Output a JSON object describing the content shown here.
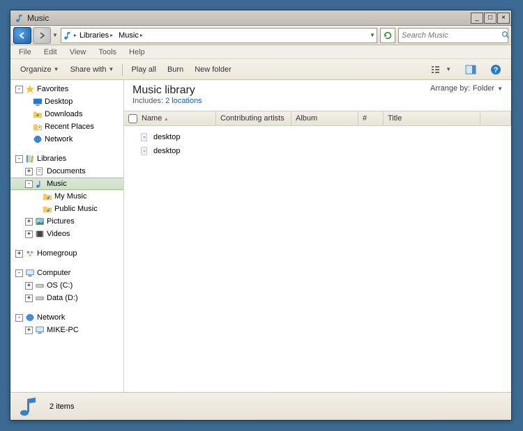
{
  "title": "Music",
  "breadcrumb": [
    "Libraries",
    "Music"
  ],
  "search_placeholder": "Search Music",
  "menu": {
    "file": "File",
    "edit": "Edit",
    "view": "View",
    "tools": "Tools",
    "help": "Help"
  },
  "cmd": {
    "organize": "Organize",
    "share": "Share with",
    "playall": "Play all",
    "burn": "Burn",
    "newfolder": "New folder"
  },
  "sidebar": {
    "favorites": {
      "label": "Favorites",
      "items": [
        "Desktop",
        "Downloads",
        "Recent Places",
        "Network"
      ]
    },
    "libraries": {
      "label": "Libraries",
      "items": {
        "documents": "Documents",
        "music": "Music",
        "mymusic": "My Music",
        "publicmusic": "Public Music",
        "pictures": "Pictures",
        "videos": "Videos"
      }
    },
    "homegroup": "Homegroup",
    "computer": {
      "label": "Computer",
      "items": [
        "OS (C:)",
        "Data (D:)"
      ]
    },
    "network": {
      "label": "Network",
      "items": [
        "MIKE-PC"
      ]
    }
  },
  "library": {
    "title": "Music library",
    "includes_label": "Includes:",
    "locations": "2 locations",
    "arrange_label": "Arrange by:",
    "arrange_value": "Folder"
  },
  "columns": {
    "name": "Name",
    "artists": "Contributing artists",
    "album": "Album",
    "num": "#",
    "title": "Title"
  },
  "files": [
    "desktop",
    "desktop"
  ],
  "status": {
    "count": "2 items"
  }
}
